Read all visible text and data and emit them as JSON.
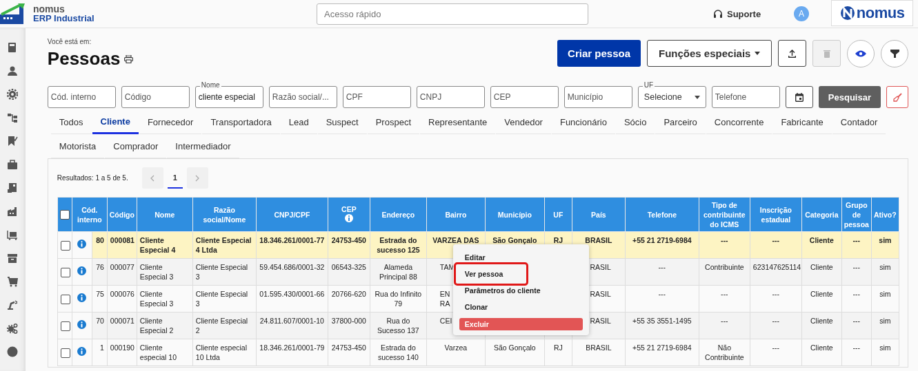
{
  "app": {
    "logo_line1": "nomus",
    "logo_line2": "ERP Industrial",
    "quick_access": {
      "placeholder": "Acesso rápido"
    },
    "support": "Suporte",
    "avatar": "A",
    "brand": "nomus"
  },
  "breadcrumb": "Você está em:",
  "title": "Pessoas",
  "actions": {
    "create": "Criar pessoa",
    "special": "Funções especiais",
    "delete_disabled": true
  },
  "filters": [
    {
      "kind": "text",
      "placeholder": "Cód. interno"
    },
    {
      "kind": "text",
      "placeholder": "Código"
    },
    {
      "kind": "text",
      "label": "Nome",
      "value": "cliente especial"
    },
    {
      "kind": "text",
      "placeholder": "Razão social/..."
    },
    {
      "kind": "text",
      "placeholder": "CPF"
    },
    {
      "kind": "text",
      "placeholder": "CNPJ"
    },
    {
      "kind": "text",
      "placeholder": "CEP"
    },
    {
      "kind": "text",
      "placeholder": "Município"
    },
    {
      "kind": "select",
      "label": "UF",
      "value": "Selecione"
    },
    {
      "kind": "text",
      "placeholder": "Telefone"
    }
  ],
  "search_button": "Pesquisar",
  "tab_rows": [
    [
      {
        "label": "Todos",
        "selected": false
      },
      {
        "label": "Cliente",
        "selected": true
      },
      {
        "label": "Fornecedor",
        "selected": false
      },
      {
        "label": "Transportadora",
        "selected": false
      },
      {
        "label": "Lead",
        "selected": false
      },
      {
        "label": "Suspect",
        "selected": false
      },
      {
        "label": "Prospect",
        "selected": false
      },
      {
        "label": "Representante",
        "selected": false
      },
      {
        "label": "Vendedor",
        "selected": false
      },
      {
        "label": "Funcionário",
        "selected": false
      },
      {
        "label": "Sócio",
        "selected": false
      },
      {
        "label": "Parceiro",
        "selected": false
      },
      {
        "label": "Concorrente",
        "selected": false
      },
      {
        "label": "Fabricante",
        "selected": false
      },
      {
        "label": "Contador",
        "selected": false
      }
    ],
    [
      {
        "label": "Motorista",
        "selected": false
      },
      {
        "label": "Comprador",
        "selected": false
      },
      {
        "label": "Intermediador",
        "selected": false
      }
    ]
  ],
  "results": "Resultados: 1 a 5 de 5.",
  "pages": [
    {
      "label": "1",
      "selected": true
    }
  ],
  "table": {
    "select_all_checked": false,
    "columns": [
      "Cód. interno",
      "Código",
      "Nome",
      "Razão social/Nome",
      "CNPJ/CPF",
      "CEP",
      "Endereço",
      "Bairro",
      "Município",
      "UF",
      "País",
      "Telefone",
      "Tipo de contribuinte do ICMS",
      "Inscrição estadual",
      "Categoria",
      "Grupo de pessoa",
      "Ativo?"
    ],
    "rows": [
      {
        "checked": false,
        "highlighted": true,
        "cells": [
          "80",
          "000081",
          "Cliente Especial 4",
          "Cliente Especial 4 Ltda",
          "18.346.261/0001-77",
          "24753-450",
          "Estrada do sucesso 125",
          "VARZEA DAS",
          "São Gonçalo",
          "RJ",
          "BRASIL",
          "+55 21 2719-6984",
          "---",
          "---",
          "Cliente",
          "---",
          "sim"
        ]
      },
      {
        "checked": false,
        "highlighted": false,
        "cells": [
          "76",
          "000077",
          "Cliente Especial 3",
          "Cliente Especial 3",
          "59.454.686/0001-32",
          "06543-325",
          "Alameda Principal 88",
          {
            "text": "TAM",
            "kind": "head"
          },
          null,
          null,
          {
            "text": "RASIL",
            "kind": "tail"
          },
          "---",
          "Contribuinte",
          "623147625114",
          "Cliente",
          "---",
          "sim"
        ]
      },
      {
        "checked": false,
        "highlighted": false,
        "cells": [
          "75",
          "000076",
          "Cliente Especial 3",
          "Cliente Especial 3",
          "01.595.430/0001-66",
          "20766-620",
          "Rua do Infinito 79",
          {
            "text": "EN RA",
            "kind": "head"
          },
          null,
          null,
          {
            "text": "RASIL",
            "kind": "tail"
          },
          "---",
          "---",
          "---",
          "Cliente",
          "---",
          "sim"
        ]
      },
      {
        "checked": false,
        "highlighted": false,
        "cells": [
          "70",
          "000071",
          "Cliente Especial 2",
          "Cliente Especial 2",
          "24.811.607/0001-10",
          "37800-000",
          "Rua do Sucesso 137",
          {
            "text": "CEI",
            "kind": "head"
          },
          null,
          null,
          {
            "text": "RASIL",
            "kind": "tail"
          },
          "+55 35 3551-1495",
          "---",
          "---",
          "Cliente",
          "---",
          "sim"
        ]
      },
      {
        "checked": false,
        "highlighted": false,
        "cells": [
          "1",
          "000190",
          "Cliente especial 10",
          "Cliente especial 10 Ltda",
          "18.346.261/0001-79",
          "24753-450",
          "Estrada do sucesso 140",
          "Varzea",
          "São Gonçalo",
          "RJ",
          "BRASIL",
          "+55 21 2719-6984",
          "Não Contribuinte",
          "---",
          "Cliente",
          "---",
          "sim"
        ]
      }
    ]
  },
  "context_menu": [
    {
      "label": "Editar",
      "kind": "normal",
      "selected": false
    },
    {
      "label": "Ver pessoa",
      "kind": "normal",
      "selected": true
    },
    {
      "label": "Parâmetros do cliente",
      "kind": "normal",
      "selected": false
    },
    {
      "label": "Clonar",
      "kind": "normal",
      "selected": false
    },
    {
      "label": "Excluir",
      "kind": "danger",
      "selected": false
    }
  ]
}
